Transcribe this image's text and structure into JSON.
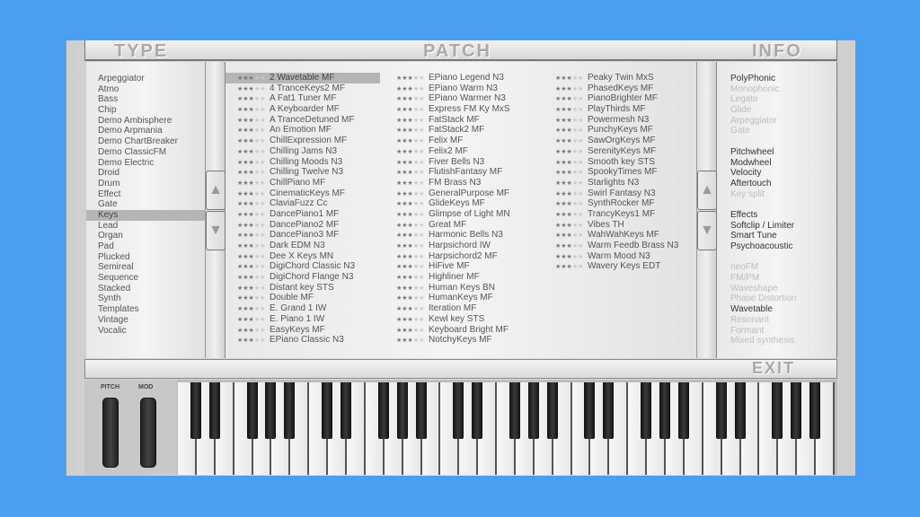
{
  "header": {
    "type_title": "TYPE",
    "patch_title": "PATCH",
    "info_title": "INFO",
    "exit_label": "EXIT"
  },
  "types": [
    "Arpeggiator",
    "Atmo",
    "Bass",
    "Chip",
    "Demo Ambisphere",
    "Demo Arpmania",
    "Demo ChartBreaker",
    "Demo ClassicFM",
    "Demo Electric",
    "Droid",
    "Drum",
    "Effect",
    "Gate",
    "Keys",
    "Lead",
    "Organ",
    "Pad",
    "Plucked",
    "Semireal",
    "Sequence",
    "Stacked",
    "Synth",
    "Templates",
    "Vintage",
    "Vocalic"
  ],
  "selected_type": "Keys",
  "patch_rating": 3,
  "patches": [
    [
      "2 Wavetable MF",
      "4 TranceKeys2 MF",
      "A Fat1 Tuner MF",
      "A Keyboarder MF",
      "A TranceDetuned MF",
      "An Emotion MF",
      "ChillExpression MF",
      "Chilling Jams N3",
      "Chilling Moods N3",
      "Chilling Twelve N3",
      "ChillPiano MF",
      "CinematicKeys MF",
      "ClaviaFuzz Cc",
      "DancePiano1 MF",
      "DancePiano2 MF",
      "DancePiano3 MF",
      "Dark EDM N3",
      "Dee X Keys MN",
      "DigiChord Classic N3",
      "DigiChord Flange N3",
      "Distant key STS",
      "Double MF",
      "E. Grand 1 IW",
      "E. Piano 1 IW",
      "EasyKeys MF",
      "EPiano Classic N3"
    ],
    [
      "EPiano Legend N3",
      "EPiano Warm N3",
      "EPiano Warmer N3",
      "Express FM Ky MxS",
      "FatStack MF",
      "FatStack2 MF",
      "Felix MF",
      "Felix2 MF",
      "Fiver Bells N3",
      "FlutishFantasy MF",
      "FM Brass N3",
      "GeneralPurpose MF",
      "GlideKeys MF",
      "Glimpse of Light MN",
      "Great MF",
      "Harmonic Bells N3",
      "Harpsichord IW",
      "Harpsichord2 MF",
      "HiFive MF",
      "Highliner MF",
      "Human Keys BN",
      "HumanKeys MF",
      "Iteration MF",
      "Kewl key STS",
      "Keyboard Bright MF",
      "NotchyKeys MF"
    ],
    [
      "Peaky Twin MxS",
      "PhasedKeys MF",
      "PianoBrighter MF",
      "PlayThirds MF",
      "Powermesh N3",
      "PunchyKeys MF",
      "SawOrgKeys MF",
      "SerenityKeys MF",
      "Smooth key STS",
      "SpookyTimes MF",
      "Starlights N3",
      "Swirl Fantasy N3",
      "SynthRocker MF",
      "TrancyKeys1 MF",
      "Vibes TH",
      "WahWahKeys MF",
      "Warm Feedb Brass N3",
      "Warm Mood N3",
      "Wavery Keys EDT"
    ]
  ],
  "selected_patch": "2 Wavetable MF",
  "info_groups": [
    [
      {
        "label": "PolyPhonic",
        "active": true
      },
      {
        "label": "Monophonic",
        "active": false
      },
      {
        "label": "Legato",
        "active": false
      },
      {
        "label": "Glide",
        "active": false
      },
      {
        "label": "Arpeggiator",
        "active": false
      },
      {
        "label": "Gate",
        "active": false
      }
    ],
    [
      {
        "label": "Pitchwheel",
        "active": true
      },
      {
        "label": "Modwheel",
        "active": true
      },
      {
        "label": "Velocity",
        "active": true
      },
      {
        "label": "Aftertouch",
        "active": true
      },
      {
        "label": "Key split",
        "active": false
      }
    ],
    [
      {
        "label": "Effects",
        "active": true
      },
      {
        "label": "Softclip / Limiter",
        "active": true
      },
      {
        "label": "Smart Tune",
        "active": true
      },
      {
        "label": "Psychoacoustic",
        "active": true
      }
    ],
    [
      {
        "label": "neoFM",
        "active": false
      },
      {
        "label": "FM/PM",
        "active": false
      },
      {
        "label": "Waveshape",
        "active": false
      },
      {
        "label": "Phase Distortion",
        "active": false
      },
      {
        "label": "Wavetable",
        "active": true
      },
      {
        "label": "Resonant",
        "active": false
      },
      {
        "label": "Formant",
        "active": false
      },
      {
        "label": "Mixed synthesis",
        "active": false
      }
    ]
  ],
  "wheels": {
    "pitch_label": "PITCH",
    "mod_label": "MOD"
  },
  "keyboard": {
    "octaves": 5,
    "start_note": "C"
  },
  "icons": {
    "scroll_up": "triangle-up-icon",
    "scroll_down": "triangle-down-icon",
    "rating": "star-icon"
  },
  "colors": {
    "background": "#4a9ff2",
    "panel": "#dcdcdc",
    "selection": "#b5b5b5"
  }
}
